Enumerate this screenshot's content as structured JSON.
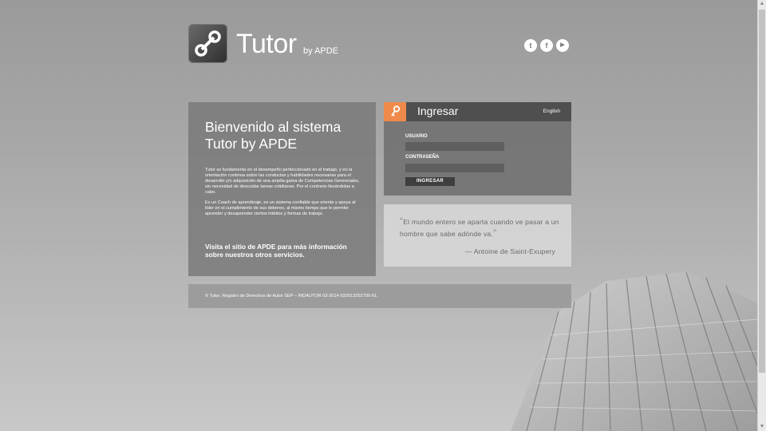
{
  "header": {
    "brand": "Tutor",
    "brand_sub": "by APDE",
    "social": [
      {
        "name": "twitter-icon",
        "glyph": "t"
      },
      {
        "name": "facebook-icon",
        "glyph": "f"
      },
      {
        "name": "youtube-icon",
        "glyph": "▶"
      }
    ]
  },
  "welcome": {
    "title": "Bienvenido al sistema Tutor by APDE",
    "para1": "Tutor se fundamenta en el desempeño perfeccionado en el trabajo, y en la orientación continua sobre las conductas y habilidades necesarias para el desarrollo y/o adquisición de una amplia gama de Competencias Gerenciales, sin necesidad de descuidar tareas cotidianas. Por el contrario llevándolas a cabo.",
    "para2": "Es un Coach de aprendizaje, es un sistema confiable que orienta y apoya al líder en el cumplimiento de sus deberes, al mismo tiempo que le permite aprender y desaprender ciertos hábitos y formas de trabajo.",
    "link": "Visita el sitio de APDE para más información sobre nuestros otros servicios."
  },
  "login": {
    "title": "Ingresar",
    "lang": "English",
    "user_label": "USUARIO",
    "user_value": "",
    "pass_label": "CONTRASEÑA",
    "pass_value": "",
    "submit": "INGRESAR",
    "accent": "#f08a4b"
  },
  "quote": {
    "open": "“",
    "text": "El mundo entero se aparta cuando ve pasar a un hombre que sabe adónde va.",
    "close": "”",
    "author": "— Antoine de Saint-Exupery"
  },
  "footer": {
    "text": "© Tutor. Registro de Derechos de Autor SEP – INDAUTOR 03-2014-032513252700-01."
  }
}
